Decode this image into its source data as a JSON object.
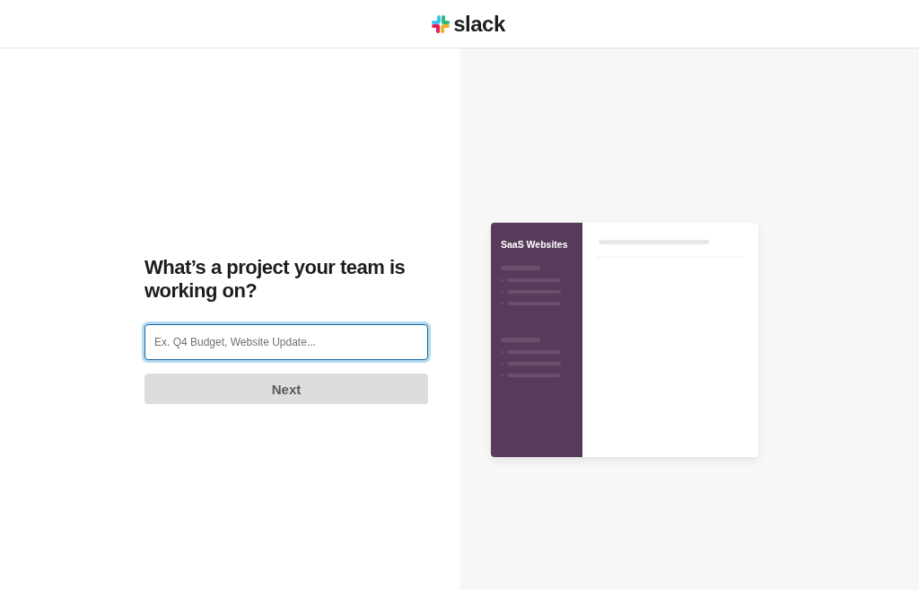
{
  "header": {
    "logo_text": "slack"
  },
  "form": {
    "question": "What’s a project your team is working on?",
    "input": {
      "placeholder": "Ex. Q4 Budget, Website Update...",
      "focused": true
    },
    "button": {
      "label": "Next",
      "disabled": true
    }
  },
  "preview": {
    "workspace_name": "SaaS Websites"
  }
}
